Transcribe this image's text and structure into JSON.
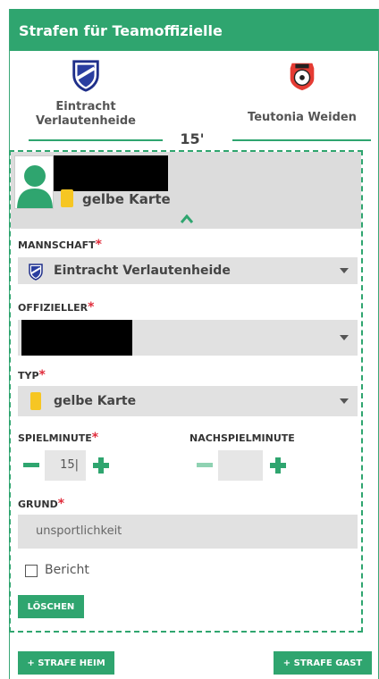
{
  "header": {
    "title": "Strafen für Teamoffizielle"
  },
  "teams": {
    "home": {
      "name": "Eintracht Verlautenheide"
    },
    "away": {
      "name": "Teutonia Weiden"
    }
  },
  "minute": "15'",
  "summary": {
    "card_label": "gelbe Karte"
  },
  "form": {
    "mannschaft_label": "MANNSCHAFT",
    "mannschaft_value": "Eintracht Verlautenheide",
    "offizieller_label": "OFFIZIELLER",
    "typ_label": "TYP",
    "typ_value": "gelbe Karte",
    "spielminute_label": "SPIELMINUTE",
    "spielminute_value": "15|",
    "nachspiel_label": "NACHSPIELMINUTE",
    "nachspiel_value": "",
    "grund_label": "GRUND",
    "grund_value": "unsportlichkeit",
    "bericht_label": "Bericht",
    "required_mark": "*"
  },
  "buttons": {
    "delete": "LÖSCHEN",
    "add_home": "+ STRAFE HEIM",
    "add_away": "+ STRAFE GAST"
  },
  "colors": {
    "accent": "#2fa56f",
    "card_yellow": "#f6c623",
    "required": "#e02d3c"
  }
}
